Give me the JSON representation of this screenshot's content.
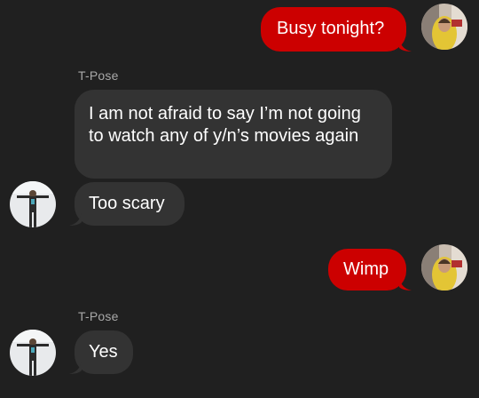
{
  "conversation": {
    "colors": {
      "background": "#202020",
      "outgoing_bubble": "#cc0000",
      "incoming_bubble": "#333333",
      "sender_name": "#a8a8a8"
    },
    "messages": [
      {
        "direction": "outgoing",
        "text": "Busy tonight?"
      },
      {
        "direction": "incoming",
        "sender": "T-Pose",
        "text": "I am not afraid to say I’m not going to watch any of y/n’s movies again"
      },
      {
        "direction": "incoming",
        "text": "Too scary"
      },
      {
        "direction": "outgoing",
        "text": "Wimp"
      },
      {
        "direction": "incoming",
        "sender": "T-Pose",
        "text": "Yes"
      }
    ]
  }
}
